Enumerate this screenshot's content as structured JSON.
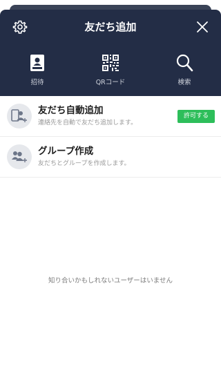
{
  "header": {
    "title": "友だち追加",
    "settings_icon": "gear-icon",
    "close_icon": "close-icon"
  },
  "menu": [
    {
      "label": "招待",
      "icon": "address-book-icon"
    },
    {
      "label": "QRコード",
      "icon": "qr-code-icon"
    },
    {
      "label": "検索",
      "icon": "search-icon"
    }
  ],
  "rows": [
    {
      "title": "友だち自動追加",
      "subtitle": "連絡先を自動で友だち追加します。",
      "icon": "phone-friends-icon",
      "button": "許可する"
    },
    {
      "title": "グループ作成",
      "subtitle": "友だちとグループを作成します。",
      "icon": "group-add-icon"
    }
  ],
  "empty_message": "知り合いかもしれないユーザーはいません",
  "colors": {
    "header_bg": "#232d46",
    "accent_green": "#2dbe5a"
  }
}
